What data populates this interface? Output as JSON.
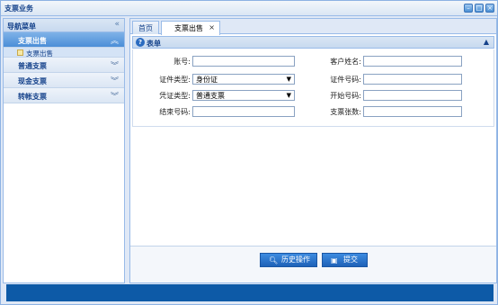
{
  "window": {
    "title": "支票业务",
    "controls": [
      "–",
      "□",
      "×"
    ]
  },
  "sidebar": {
    "header": "导航菜单",
    "collapse_glyph": "«",
    "sections": [
      {
        "label": "支票出售",
        "glyph": "︽",
        "active": true
      },
      {
        "label": "普通支票",
        "glyph": "︾"
      },
      {
        "label": "现金支票",
        "glyph": "︾"
      },
      {
        "label": "转帐支票",
        "glyph": "︾"
      }
    ],
    "subitem": {
      "label": "支票出售",
      "icon": "page-icon"
    }
  },
  "tabs": [
    {
      "label": "首页"
    },
    {
      "label": "支票出售",
      "close": "×"
    }
  ],
  "panel": {
    "title": "表单",
    "icon": "help-icon",
    "collapse_glyph": "▲"
  },
  "form": {
    "account_label": "账号:",
    "account_value": "",
    "customer_label": "客户姓名:",
    "customer_value": "",
    "idtype_label": "证件类型:",
    "idtype_value": "身份证",
    "idnum_label": "证件号码:",
    "idnum_value": "",
    "vouchertype_label": "凭证类型:",
    "vouchertype_value": "普通支票",
    "startnum_label": "开始号码:",
    "startnum_value": "",
    "endnum_label": "结束号码:",
    "endnum_value": "",
    "count_label": "支票张数:",
    "count_value": ""
  },
  "buttons": {
    "history": {
      "label": "历史操作",
      "icon": "search-icon"
    },
    "submit": {
      "label": "提交",
      "icon": "save-icon"
    }
  },
  "colors": {
    "accent": "#1e62b8",
    "statusbar": "#0d5aa7",
    "border": "#99bbe8"
  }
}
